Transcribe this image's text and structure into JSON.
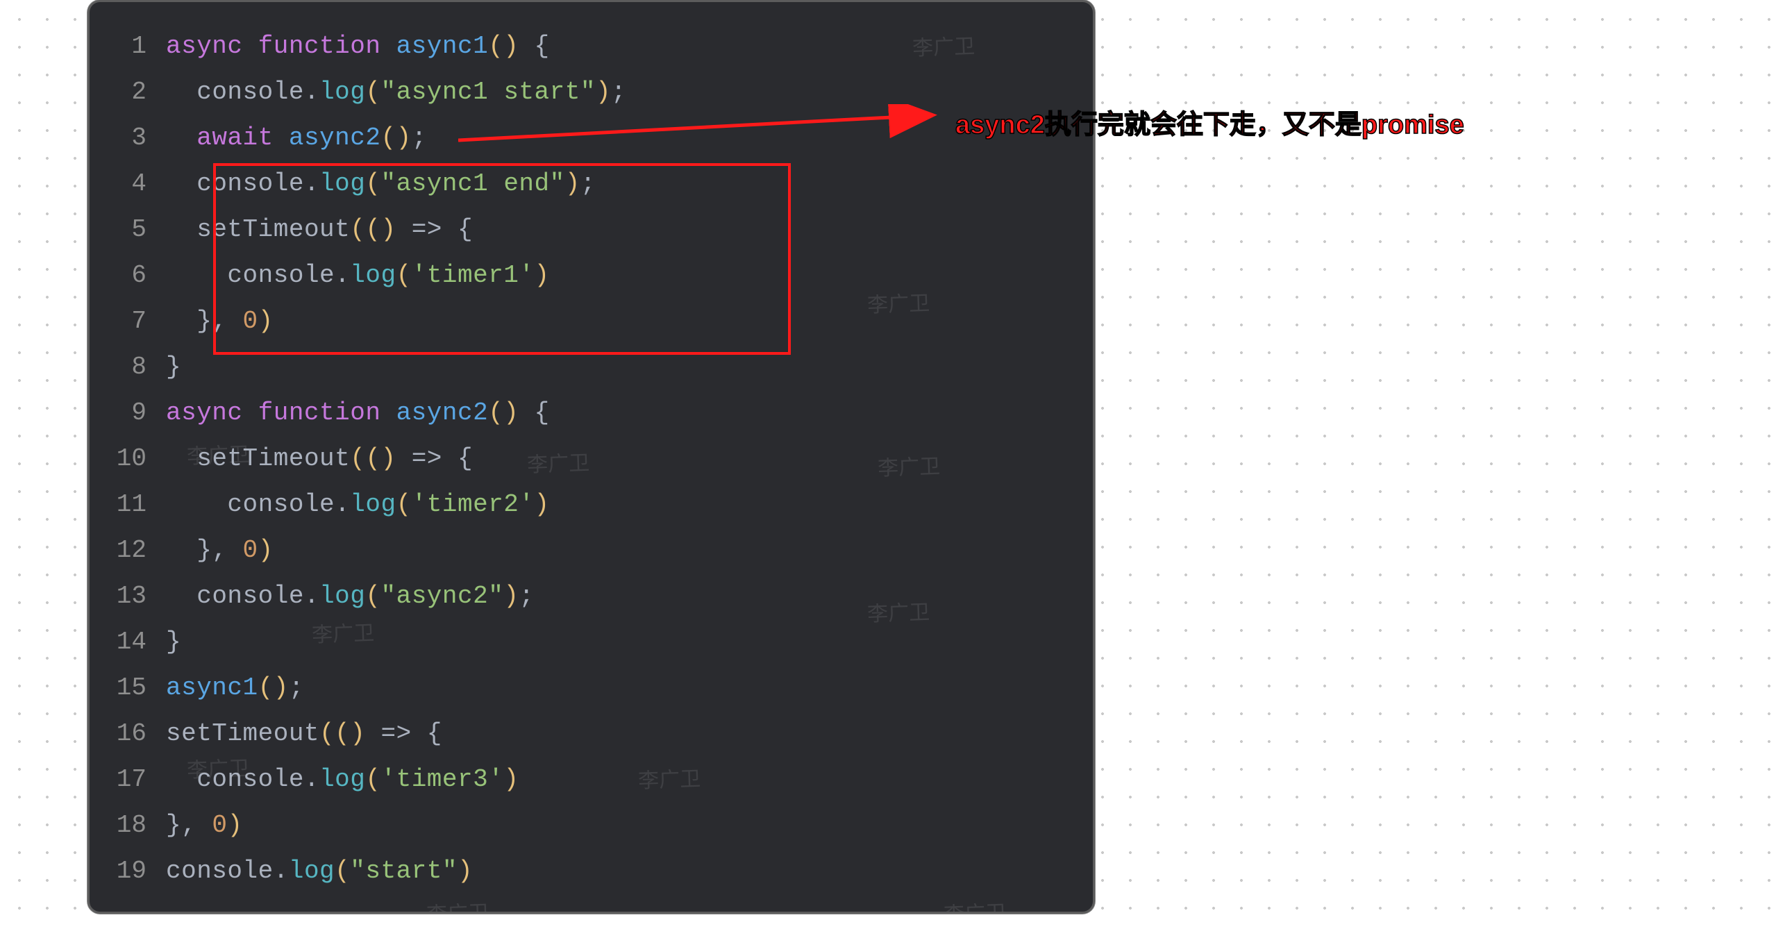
{
  "annotation": "async2执行完就会往下走，又不是promise",
  "watermark_text": "李广卫",
  "code_lines": [
    {
      "n": "1",
      "tokens": [
        {
          "t": "async ",
          "c": "kw2"
        },
        {
          "t": "function ",
          "c": "kw2"
        },
        {
          "t": "async1",
          "c": "fn"
        },
        {
          "t": "(",
          "c": "paren"
        },
        {
          "t": ")",
          "c": "paren"
        },
        {
          "t": " {",
          "c": "brace"
        }
      ]
    },
    {
      "n": "2",
      "tokens": [
        {
          "t": "  ",
          "c": "plain"
        },
        {
          "t": "console",
          "c": "ident"
        },
        {
          "t": ".",
          "c": "op"
        },
        {
          "t": "log",
          "c": "method"
        },
        {
          "t": "(",
          "c": "paren"
        },
        {
          "t": "\"async1 start\"",
          "c": "str"
        },
        {
          "t": ")",
          "c": "paren"
        },
        {
          "t": ";",
          "c": "semi"
        }
      ]
    },
    {
      "n": "3",
      "tokens": [
        {
          "t": "  ",
          "c": "plain"
        },
        {
          "t": "await ",
          "c": "kw2"
        },
        {
          "t": "async2",
          "c": "fn"
        },
        {
          "t": "(",
          "c": "paren"
        },
        {
          "t": ")",
          "c": "paren"
        },
        {
          "t": ";",
          "c": "semi"
        }
      ]
    },
    {
      "n": "4",
      "tokens": [
        {
          "t": "  ",
          "c": "plain"
        },
        {
          "t": "console",
          "c": "ident"
        },
        {
          "t": ".",
          "c": "op"
        },
        {
          "t": "log",
          "c": "method"
        },
        {
          "t": "(",
          "c": "paren"
        },
        {
          "t": "\"async1 end\"",
          "c": "str"
        },
        {
          "t": ")",
          "c": "paren"
        },
        {
          "t": ";",
          "c": "semi"
        }
      ]
    },
    {
      "n": "5",
      "tokens": [
        {
          "t": "  ",
          "c": "plain"
        },
        {
          "t": "setTimeout",
          "c": "ident"
        },
        {
          "t": "((",
          "c": "paren"
        },
        {
          "t": ")",
          "c": "paren"
        },
        {
          "t": " => ",
          "c": "op"
        },
        {
          "t": "{",
          "c": "brace"
        }
      ]
    },
    {
      "n": "6",
      "tokens": [
        {
          "t": "    ",
          "c": "plain"
        },
        {
          "t": "console",
          "c": "ident"
        },
        {
          "t": ".",
          "c": "op"
        },
        {
          "t": "log",
          "c": "method"
        },
        {
          "t": "(",
          "c": "paren"
        },
        {
          "t": "'timer1'",
          "c": "str"
        },
        {
          "t": ")",
          "c": "paren"
        }
      ]
    },
    {
      "n": "7",
      "tokens": [
        {
          "t": "  ",
          "c": "plain"
        },
        {
          "t": "}",
          "c": "brace"
        },
        {
          "t": ", ",
          "c": "op"
        },
        {
          "t": "0",
          "c": "num"
        },
        {
          "t": ")",
          "c": "paren"
        }
      ]
    },
    {
      "n": "8",
      "tokens": [
        {
          "t": "}",
          "c": "brace"
        }
      ]
    },
    {
      "n": "9",
      "tokens": [
        {
          "t": "async ",
          "c": "kw2"
        },
        {
          "t": "function ",
          "c": "kw2"
        },
        {
          "t": "async2",
          "c": "fn"
        },
        {
          "t": "(",
          "c": "paren"
        },
        {
          "t": ")",
          "c": "paren"
        },
        {
          "t": " {",
          "c": "brace"
        }
      ]
    },
    {
      "n": "10",
      "tokens": [
        {
          "t": "  ",
          "c": "plain"
        },
        {
          "t": "setTimeout",
          "c": "ident"
        },
        {
          "t": "((",
          "c": "paren"
        },
        {
          "t": ")",
          "c": "paren"
        },
        {
          "t": " => ",
          "c": "op"
        },
        {
          "t": "{",
          "c": "brace"
        }
      ]
    },
    {
      "n": "11",
      "tokens": [
        {
          "t": "    ",
          "c": "plain"
        },
        {
          "t": "console",
          "c": "ident"
        },
        {
          "t": ".",
          "c": "op"
        },
        {
          "t": "log",
          "c": "method"
        },
        {
          "t": "(",
          "c": "paren"
        },
        {
          "t": "'timer2'",
          "c": "str"
        },
        {
          "t": ")",
          "c": "paren"
        }
      ]
    },
    {
      "n": "12",
      "tokens": [
        {
          "t": "  ",
          "c": "plain"
        },
        {
          "t": "}",
          "c": "brace"
        },
        {
          "t": ", ",
          "c": "op"
        },
        {
          "t": "0",
          "c": "num"
        },
        {
          "t": ")",
          "c": "paren"
        }
      ]
    },
    {
      "n": "13",
      "tokens": [
        {
          "t": "  ",
          "c": "plain"
        },
        {
          "t": "console",
          "c": "ident"
        },
        {
          "t": ".",
          "c": "op"
        },
        {
          "t": "log",
          "c": "method"
        },
        {
          "t": "(",
          "c": "paren"
        },
        {
          "t": "\"async2\"",
          "c": "str"
        },
        {
          "t": ")",
          "c": "paren"
        },
        {
          "t": ";",
          "c": "semi"
        }
      ]
    },
    {
      "n": "14",
      "tokens": [
        {
          "t": "}",
          "c": "brace"
        }
      ]
    },
    {
      "n": "15",
      "tokens": [
        {
          "t": "async1",
          "c": "fn"
        },
        {
          "t": "(",
          "c": "paren"
        },
        {
          "t": ")",
          "c": "paren"
        },
        {
          "t": ";",
          "c": "semi"
        }
      ]
    },
    {
      "n": "16",
      "tokens": [
        {
          "t": "setTimeout",
          "c": "ident"
        },
        {
          "t": "((",
          "c": "paren"
        },
        {
          "t": ")",
          "c": "paren"
        },
        {
          "t": " => ",
          "c": "op"
        },
        {
          "t": "{",
          "c": "brace"
        }
      ]
    },
    {
      "n": "17",
      "tokens": [
        {
          "t": "  ",
          "c": "plain"
        },
        {
          "t": "console",
          "c": "ident"
        },
        {
          "t": ".",
          "c": "op"
        },
        {
          "t": "log",
          "c": "method"
        },
        {
          "t": "(",
          "c": "paren"
        },
        {
          "t": "'timer3'",
          "c": "str"
        },
        {
          "t": ")",
          "c": "paren"
        }
      ]
    },
    {
      "n": "18",
      "tokens": [
        {
          "t": "}",
          "c": "brace"
        },
        {
          "t": ", ",
          "c": "op"
        },
        {
          "t": "0",
          "c": "num"
        },
        {
          "t": ")",
          "c": "paren"
        }
      ]
    },
    {
      "n": "19",
      "tokens": [
        {
          "t": "console",
          "c": "ident"
        },
        {
          "t": ".",
          "c": "op"
        },
        {
          "t": "log",
          "c": "method"
        },
        {
          "t": "(",
          "c": "paren"
        },
        {
          "t": "\"start\"",
          "c": "str"
        },
        {
          "t": ")",
          "c": "paren"
        }
      ]
    }
  ]
}
